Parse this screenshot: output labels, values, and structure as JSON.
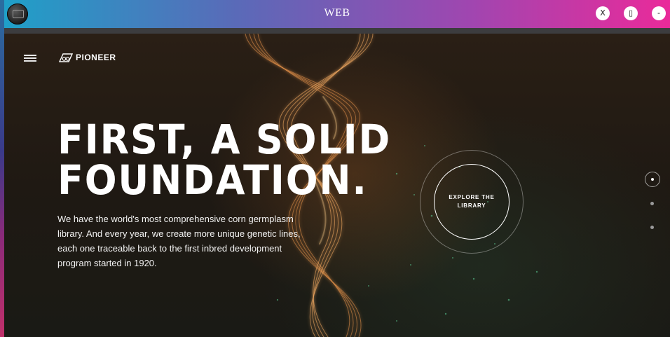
{
  "window": {
    "title": "WEB",
    "close_label": "X",
    "maximize_label": "▯",
    "minimize_label": "-"
  },
  "site": {
    "brand": "PIONEER"
  },
  "hero": {
    "headline_line1": "FIRST, A SOLID",
    "headline_line2": "FOUNDATION.",
    "body_line1": "We have the world's most comprehensive corn germplasm",
    "body_line2": "library. And every year, we create more unique genetic lines,",
    "body_line3": "each one traceable back to the first inbred development",
    "body_line4": "program started in 1920.",
    "cta_line1": "EXPLORE THE",
    "cta_line2": "LIBRARY"
  },
  "pager": {
    "count": 3,
    "active_index": 0
  },
  "colors": {
    "titlebar_start": "#1fa0c8",
    "titlebar_end": "#ea2a9a",
    "helix": "#e8944a",
    "background": "#1f1913"
  }
}
